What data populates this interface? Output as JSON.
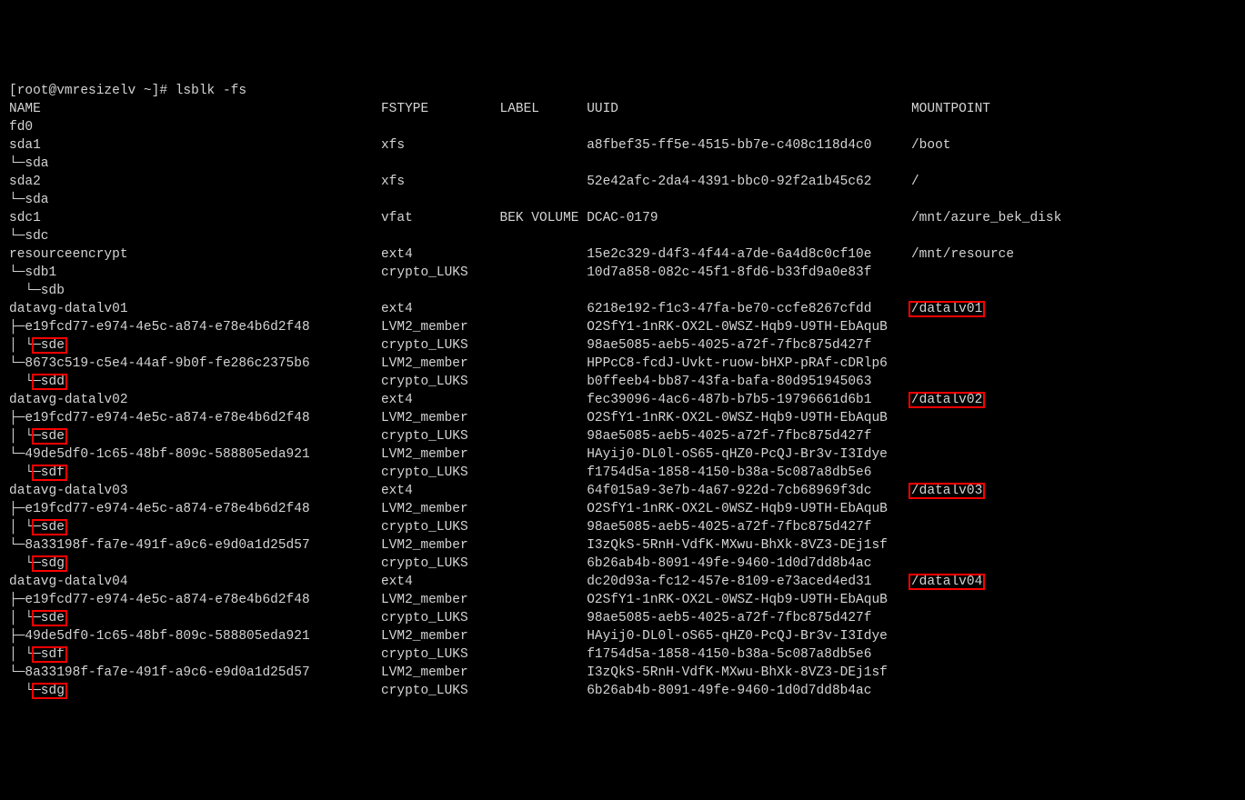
{
  "prompt": "[root@vmresizelv ~]# ",
  "command": "lsblk -fs",
  "cols": {
    "name_pad": 47,
    "fstype_pad": 15,
    "label_pad": 11,
    "uuid_pad": 41
  },
  "header": {
    "name": "NAME",
    "fstype": "FSTYPE",
    "label": "LABEL",
    "uuid": "UUID",
    "mount": "MOUNTPOINT"
  },
  "lines": [
    {
      "name": "fd0",
      "fstype": "",
      "label": "",
      "uuid": "",
      "mount": ""
    },
    {
      "name": "sda1",
      "fstype": "xfs",
      "label": "",
      "uuid": "a8fbef35-ff5e-4515-bb7e-c408c118d4c0",
      "mount": "/boot"
    },
    {
      "name": "└─sda",
      "fstype": "",
      "label": "",
      "uuid": "",
      "mount": ""
    },
    {
      "name": "sda2",
      "fstype": "xfs",
      "label": "",
      "uuid": "52e42afc-2da4-4391-bbc0-92f2a1b45c62",
      "mount": "/"
    },
    {
      "name": "└─sda",
      "fstype": "",
      "label": "",
      "uuid": "",
      "mount": ""
    },
    {
      "name": "sdc1",
      "fstype": "vfat",
      "label": "BEK VOLUME",
      "uuid": "DCAC-0179",
      "mount": "/mnt/azure_bek_disk"
    },
    {
      "name": "└─sdc",
      "fstype": "",
      "label": "",
      "uuid": "",
      "mount": ""
    },
    {
      "name": "resourceencrypt",
      "fstype": "ext4",
      "label": "",
      "uuid": "15e2c329-d4f3-4f44-a7de-6a4d8c0cf10e",
      "mount": "/mnt/resource"
    },
    {
      "name": "└─sdb1",
      "fstype": "crypto_LUKS",
      "label": "",
      "uuid": "10d7a858-082c-45f1-8fd6-b33fd9a0e83f",
      "mount": ""
    },
    {
      "name": "  └─sdb",
      "fstype": "",
      "label": "",
      "uuid": "",
      "mount": ""
    },
    {
      "name": "datavg-datalv01",
      "fstype": "ext4",
      "label": "",
      "uuid": "6218e192-f1c3-47fa-be70-ccfe8267cfdd",
      "mount": "/datalv01",
      "hlmount": true
    },
    {
      "name": "├─e19fcd77-e974-4e5c-a874-e78e4b6d2f48",
      "fstype": "LVM2_member",
      "label": "",
      "uuid": "O2SfY1-1nRK-OX2L-0WSZ-Hqb9-U9TH-EbAquB",
      "mount": ""
    },
    {
      "name": "│ └─sde",
      "fstype": "crypto_LUKS",
      "label": "",
      "uuid": "98ae5085-aeb5-4025-a72f-7fbc875d427f",
      "mount": "",
      "hlname": true
    },
    {
      "name": "└─8673c519-c5e4-44af-9b0f-fe286c2375b6",
      "fstype": "LVM2_member",
      "label": "",
      "uuid": "HPPcC8-fcdJ-Uvkt-ruow-bHXP-pRAf-cDRlp6",
      "mount": ""
    },
    {
      "name": "  └─sdd",
      "fstype": "crypto_LUKS",
      "label": "",
      "uuid": "b0ffeeb4-bb87-43fa-bafa-80d951945063",
      "mount": "",
      "hlname": true
    },
    {
      "name": "datavg-datalv02",
      "fstype": "ext4",
      "label": "",
      "uuid": "fec39096-4ac6-487b-b7b5-19796661d6b1",
      "mount": "/datalv02",
      "hlmount": true
    },
    {
      "name": "├─e19fcd77-e974-4e5c-a874-e78e4b6d2f48",
      "fstype": "LVM2_member",
      "label": "",
      "uuid": "O2SfY1-1nRK-OX2L-0WSZ-Hqb9-U9TH-EbAquB",
      "mount": ""
    },
    {
      "name": "│ └─sde",
      "fstype": "crypto_LUKS",
      "label": "",
      "uuid": "98ae5085-aeb5-4025-a72f-7fbc875d427f",
      "mount": "",
      "hlname": true
    },
    {
      "name": "└─49de5df0-1c65-48bf-809c-588805eda921",
      "fstype": "LVM2_member",
      "label": "",
      "uuid": "HAyij0-DL0l-oS65-qHZ0-PcQJ-Br3v-I3Idye",
      "mount": ""
    },
    {
      "name": "  └─sdf",
      "fstype": "crypto_LUKS",
      "label": "",
      "uuid": "f1754d5a-1858-4150-b38a-5c087a8db5e6",
      "mount": "",
      "hlname": true
    },
    {
      "name": "datavg-datalv03",
      "fstype": "ext4",
      "label": "",
      "uuid": "64f015a9-3e7b-4a67-922d-7cb68969f3dc",
      "mount": "/datalv03",
      "hlmount": true
    },
    {
      "name": "├─e19fcd77-e974-4e5c-a874-e78e4b6d2f48",
      "fstype": "LVM2_member",
      "label": "",
      "uuid": "O2SfY1-1nRK-OX2L-0WSZ-Hqb9-U9TH-EbAquB",
      "mount": ""
    },
    {
      "name": "│ └─sde",
      "fstype": "crypto_LUKS",
      "label": "",
      "uuid": "98ae5085-aeb5-4025-a72f-7fbc875d427f",
      "mount": "",
      "hlname": true
    },
    {
      "name": "└─8a33198f-fa7e-491f-a9c6-e9d0a1d25d57",
      "fstype": "LVM2_member",
      "label": "",
      "uuid": "I3zQkS-5RnH-VdfK-MXwu-BhXk-8VZ3-DEj1sf",
      "mount": ""
    },
    {
      "name": "  └─sdg",
      "fstype": "crypto_LUKS",
      "label": "",
      "uuid": "6b26ab4b-8091-49fe-9460-1d0d7dd8b4ac",
      "mount": "",
      "hlname": true
    },
    {
      "name": "datavg-datalv04",
      "fstype": "ext4",
      "label": "",
      "uuid": "dc20d93a-fc12-457e-8109-e73aced4ed31",
      "mount": "/datalv04",
      "hlmount": true
    },
    {
      "name": "├─e19fcd77-e974-4e5c-a874-e78e4b6d2f48",
      "fstype": "LVM2_member",
      "label": "",
      "uuid": "O2SfY1-1nRK-OX2L-0WSZ-Hqb9-U9TH-EbAquB",
      "mount": ""
    },
    {
      "name": "│ └─sde",
      "fstype": "crypto_LUKS",
      "label": "",
      "uuid": "98ae5085-aeb5-4025-a72f-7fbc875d427f",
      "mount": "",
      "hlname": true
    },
    {
      "name": "├─49de5df0-1c65-48bf-809c-588805eda921",
      "fstype": "LVM2_member",
      "label": "",
      "uuid": "HAyij0-DL0l-oS65-qHZ0-PcQJ-Br3v-I3Idye",
      "mount": ""
    },
    {
      "name": "│ └─sdf",
      "fstype": "crypto_LUKS",
      "label": "",
      "uuid": "f1754d5a-1858-4150-b38a-5c087a8db5e6",
      "mount": "",
      "hlname": true
    },
    {
      "name": "└─8a33198f-fa7e-491f-a9c6-e9d0a1d25d57",
      "fstype": "LVM2_member",
      "label": "",
      "uuid": "I3zQkS-5RnH-VdfK-MXwu-BhXk-8VZ3-DEj1sf",
      "mount": ""
    },
    {
      "name": "  └─sdg",
      "fstype": "crypto_LUKS",
      "label": "",
      "uuid": "6b26ab4b-8091-49fe-9460-1d0d7dd8b4ac",
      "mount": "",
      "hlname": true
    }
  ]
}
